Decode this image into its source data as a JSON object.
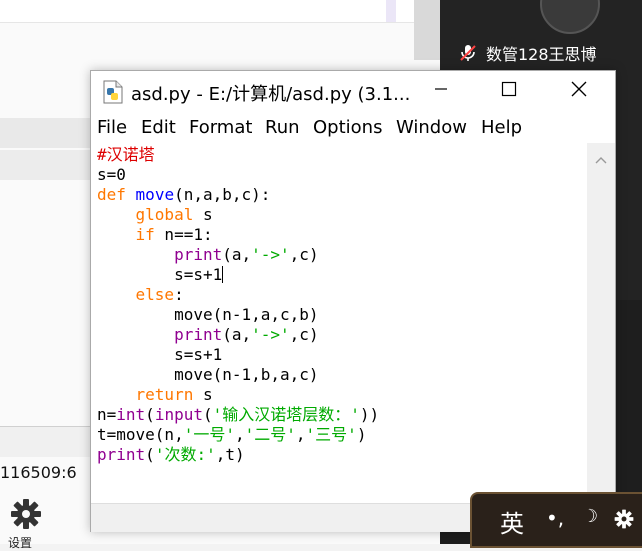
{
  "background": {
    "status_text": "116509:6",
    "settings_label": "设置"
  },
  "side_panel": {
    "user_name": "数管128王思博",
    "icons": [
      "muted-mic-icon",
      "avatar"
    ]
  },
  "idle_window": {
    "title": "asd.py - E:/计算机/asd.py (3.1...",
    "controls": [
      "minimize-icon",
      "maximize-icon",
      "close-icon"
    ],
    "menu": [
      "File",
      "Edit",
      "Format",
      "Run",
      "Options",
      "Window",
      "Help"
    ],
    "code_lines": [
      "#汉诺塔",
      "s=0",
      "def move(n,a,b,c):",
      "    global s",
      "    if n==1:",
      "        print(a,'->',c)",
      "        s=s+1",
      "    else:",
      "        move(n-1,a,c,b)",
      "        print(a,'->',c)",
      "        s=s+1",
      "        move(n-1,b,a,c)",
      "    return s",
      "n=int(input('输入汉诺塔层数：'))",
      "t=move(n,'一号','二号','三号')",
      "print('次数:',t)"
    ]
  },
  "ime_bar": {
    "language": "英",
    "punct": "•,",
    "mode_icon": "moon-icon",
    "settings_icon": "gear-icon"
  },
  "colors": {
    "keyword": "#ff7700",
    "builtin": "#900090",
    "string": "#00aa00",
    "comment": "#dd0000",
    "defname": "#0000ff"
  }
}
